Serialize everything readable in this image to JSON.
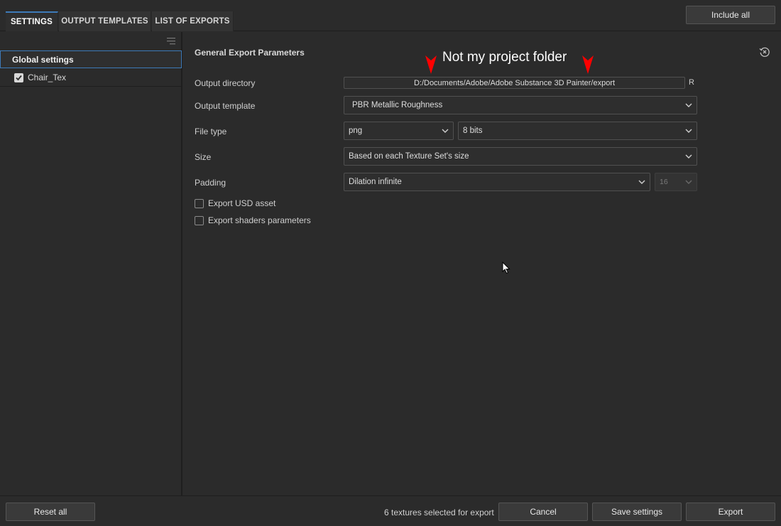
{
  "tabs": [
    {
      "label": "SETTINGS",
      "active": true
    },
    {
      "label": "OUTPUT TEMPLATES",
      "active": false
    },
    {
      "label": "LIST OF EXPORTS",
      "active": false
    }
  ],
  "header": {
    "include_all_label": "Include all"
  },
  "sidebar": {
    "global_settings_label": "Global settings",
    "texture_sets": [
      {
        "label": "Chair_Tex",
        "checked": true
      }
    ]
  },
  "main": {
    "section_title": "General Export Parameters",
    "output_directory": {
      "label": "Output directory",
      "value": "D:/Documents/Adobe/Adobe Substance 3D Painter/export",
      "button_label": "R"
    },
    "output_template": {
      "label": "Output template",
      "value": "PBR Metallic Roughness"
    },
    "file_type": {
      "label": "File type",
      "format": "png",
      "bit_depth": "8 bits"
    },
    "size": {
      "label": "Size",
      "value": "Based on each Texture Set's size"
    },
    "padding": {
      "label": "Padding",
      "value": "Dilation infinite",
      "distance": "16"
    },
    "export_usd": {
      "label": "Export USD asset",
      "checked": false
    },
    "export_shaders": {
      "label": "Export shaders parameters",
      "checked": false
    }
  },
  "annotation": {
    "text": "Not my project folder",
    "color": "#ff0000"
  },
  "footer": {
    "reset_all_label": "Reset all",
    "status_text": "6 textures selected for export",
    "cancel_label": "Cancel",
    "save_settings_label": "Save settings",
    "export_label": "Export"
  },
  "colors": {
    "accent": "#3d7ab8",
    "background": "#2b2b2b"
  }
}
